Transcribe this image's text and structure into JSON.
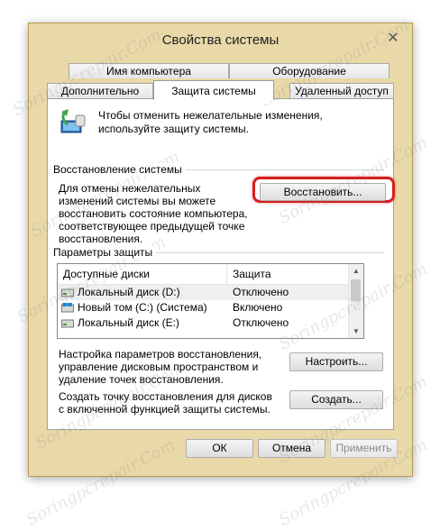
{
  "window": {
    "title": "Свойства системы",
    "close_symbol": "✕"
  },
  "tabs": {
    "top_row": [
      "Имя компьютера",
      "Оборудование"
    ],
    "bottom_row": [
      "Дополнительно",
      "Защита системы",
      "Удаленный доступ"
    ],
    "active": "Защита системы"
  },
  "intro": {
    "text": "Чтобы отменить нежелательные изменения, используйте защиту системы.",
    "icon": "system-protection-icon"
  },
  "restore_section": {
    "title": "Восстановление системы",
    "description": "Для отмены нежелательных изменений системы вы можете восстановить состояние компьютера, соответствующее предыдущей точке восстановления.",
    "button": "Восстановить..."
  },
  "protection_section": {
    "title": "Параметры защиты",
    "columns": [
      "Доступные диски",
      "Защита"
    ],
    "drives": [
      {
        "name": "Локальный диск (D:)",
        "status": "Отключено",
        "icon": "drive-icon",
        "selected": true
      },
      {
        "name": "Новый том (C:) (Система)",
        "status": "Включено",
        "icon": "system-drive-icon",
        "selected": false
      },
      {
        "name": "Локальный диск (E:)",
        "status": "Отключено",
        "icon": "drive-icon",
        "selected": false
      }
    ],
    "configure_text": "Настройка параметров восстановления, управление дисковым пространством и удаление точек восстановления.",
    "configure_button": "Настроить...",
    "create_text": "Создать точку восстановления для дисков с включенной функцией защиты системы.",
    "create_button": "Создать..."
  },
  "footer": {
    "ok": "ОК",
    "cancel": "Отмена",
    "apply": "Применить"
  },
  "watermark": "Soringpcrepair.Com",
  "colors": {
    "window_frame": "#e9d9a8",
    "highlight": "#d61d1d"
  }
}
